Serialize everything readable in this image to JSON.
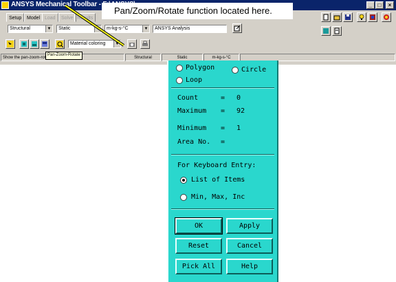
{
  "window": {
    "title": "ANSYS Mechanical Toolbar - F:\\ANSYS\\",
    "min_label": "_",
    "max_label": "□",
    "close_label": "×"
  },
  "tabs": [
    {
      "label": "Setup",
      "state": "active"
    },
    {
      "label": "Model",
      "state": "normal"
    },
    {
      "label": "Load",
      "state": "disabled"
    },
    {
      "label": "Solve",
      "state": "disabled"
    },
    {
      "label": "Results",
      "state": "disabled"
    }
  ],
  "selectors": {
    "discipline": "Structural",
    "analysis_type": "Static",
    "units": "m-kg-s-°C",
    "analysis_name": "ANSYS Analysis",
    "display": "Material coloring"
  },
  "tooltip": "Pan-Zoom-Rotate",
  "status_bar": {
    "hint": "Show the pan-zoom-rotate dialog",
    "discipline": "Structural",
    "analysis": "Static",
    "units": "m-kg-s-°C"
  },
  "callout": "Pan/Zoom/Rotate function located here.",
  "dialog": {
    "pick_modes": {
      "polygon": "Polygon",
      "circle": "Circle",
      "loop": "Loop"
    },
    "stats": {
      "count_label": "Count",
      "count_value": "0",
      "maximum_label": "Maximum",
      "maximum_value": "92",
      "minimum_label": "Minimum",
      "minimum_value": "1",
      "area_label": "Area No.",
      "equals": "="
    },
    "keyboard_entry_label": "For Keyboard Entry:",
    "entry_modes": {
      "list": "List of Items",
      "range": "Min, Max, Inc",
      "selected": "list"
    },
    "buttons": {
      "ok": "OK",
      "apply": "Apply",
      "reset": "Reset",
      "cancel": "Cancel",
      "pick_all": "Pick All",
      "help": "Help"
    }
  },
  "colors": {
    "dialog_bg": "#2ad7cd",
    "titlebar": "#0a246a",
    "toolbar_bg": "#d4d0c8"
  }
}
